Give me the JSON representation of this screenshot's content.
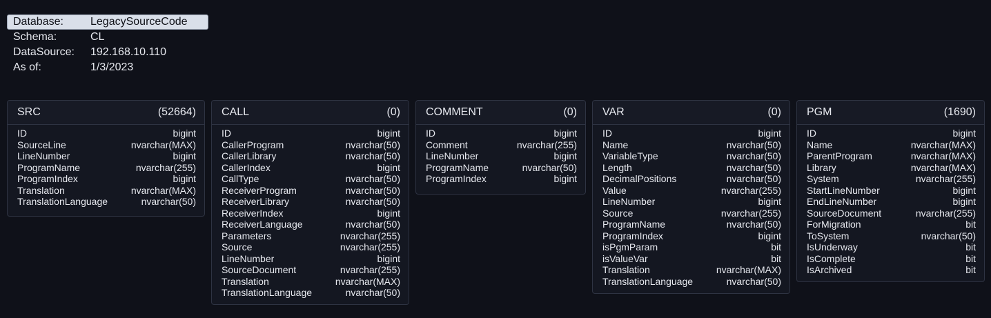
{
  "info": [
    {
      "key": "Database:",
      "value": "LegacySourceCode",
      "selected": true
    },
    {
      "key": "Schema:",
      "value": "CL"
    },
    {
      "key": "DataSource:",
      "value": "192.168.10.110"
    },
    {
      "key": "As of:",
      "value": "1/3/2023"
    }
  ],
  "tables": [
    {
      "name": "SRC",
      "count": "(52664)",
      "fields": [
        {
          "name": "ID",
          "type": "bigint"
        },
        {
          "name": "SourceLine",
          "type": "nvarchar(MAX)"
        },
        {
          "name": "LineNumber",
          "type": "bigint"
        },
        {
          "name": "ProgramName",
          "type": "nvarchar(255)"
        },
        {
          "name": "ProgramIndex",
          "type": "bigint"
        },
        {
          "name": "Translation",
          "type": "nvarchar(MAX)"
        },
        {
          "name": "TranslationLanguage",
          "type": "nvarchar(50)"
        }
      ]
    },
    {
      "name": "CALL",
      "count": "(0)",
      "fields": [
        {
          "name": "ID",
          "type": "bigint"
        },
        {
          "name": "CallerProgram",
          "type": "nvarchar(50)"
        },
        {
          "name": "CallerLibrary",
          "type": "nvarchar(50)"
        },
        {
          "name": "CallerIndex",
          "type": "bigint"
        },
        {
          "name": "CallType",
          "type": "nvarchar(50)"
        },
        {
          "name": "ReceiverProgram",
          "type": "nvarchar(50)"
        },
        {
          "name": "ReceiverLibrary",
          "type": "nvarchar(50)"
        },
        {
          "name": "ReceiverIndex",
          "type": "bigint"
        },
        {
          "name": "ReceiverLanguage",
          "type": "nvarchar(50)"
        },
        {
          "name": "Parameters",
          "type": "nvarchar(255)"
        },
        {
          "name": "Source",
          "type": "nvarchar(255)"
        },
        {
          "name": "LineNumber",
          "type": "bigint"
        },
        {
          "name": "SourceDocument",
          "type": "nvarchar(255)"
        },
        {
          "name": "Translation",
          "type": "nvarchar(MAX)"
        },
        {
          "name": "TranslationLanguage",
          "type": "nvarchar(50)"
        }
      ]
    },
    {
      "name": "COMMENT",
      "count": "(0)",
      "fields": [
        {
          "name": "ID",
          "type": "bigint"
        },
        {
          "name": "Comment",
          "type": "nvarchar(255)"
        },
        {
          "name": "LineNumber",
          "type": "bigint"
        },
        {
          "name": "ProgramName",
          "type": "nvarchar(50)"
        },
        {
          "name": "ProgramIndex",
          "type": "bigint"
        }
      ]
    },
    {
      "name": "VAR",
      "count": "(0)",
      "fields": [
        {
          "name": "ID",
          "type": "bigint"
        },
        {
          "name": "Name",
          "type": "nvarchar(50)"
        },
        {
          "name": "VariableType",
          "type": "nvarchar(50)"
        },
        {
          "name": "Length",
          "type": "nvarchar(50)"
        },
        {
          "name": "DecimalPositions",
          "type": "nvarchar(50)"
        },
        {
          "name": "Value",
          "type": "nvarchar(255)"
        },
        {
          "name": "LineNumber",
          "type": "bigint"
        },
        {
          "name": "Source",
          "type": "nvarchar(255)"
        },
        {
          "name": "ProgramName",
          "type": "nvarchar(50)"
        },
        {
          "name": "ProgramIndex",
          "type": "bigint"
        },
        {
          "name": "isPgmParam",
          "type": "bit"
        },
        {
          "name": "isValueVar",
          "type": "bit"
        },
        {
          "name": "Translation",
          "type": "nvarchar(MAX)"
        },
        {
          "name": "TranslationLanguage",
          "type": "nvarchar(50)"
        }
      ]
    },
    {
      "name": "PGM",
      "count": "(1690)",
      "fields": [
        {
          "name": "ID",
          "type": "bigint"
        },
        {
          "name": "Name",
          "type": "nvarchar(MAX)"
        },
        {
          "name": "ParentProgram",
          "type": "nvarchar(MAX)"
        },
        {
          "name": "Library",
          "type": "nvarchar(MAX)"
        },
        {
          "name": "System",
          "type": "nvarchar(255)"
        },
        {
          "name": "StartLineNumber",
          "type": "bigint"
        },
        {
          "name": "EndLineNumber",
          "type": "bigint"
        },
        {
          "name": "SourceDocument",
          "type": "nvarchar(255)"
        },
        {
          "name": "ForMigration",
          "type": "bit"
        },
        {
          "name": "ToSystem",
          "type": "nvarchar(50)"
        },
        {
          "name": "IsUnderway",
          "type": "bit"
        },
        {
          "name": "IsComplete",
          "type": "bit"
        },
        {
          "name": "IsArchived",
          "type": "bit"
        }
      ]
    }
  ]
}
